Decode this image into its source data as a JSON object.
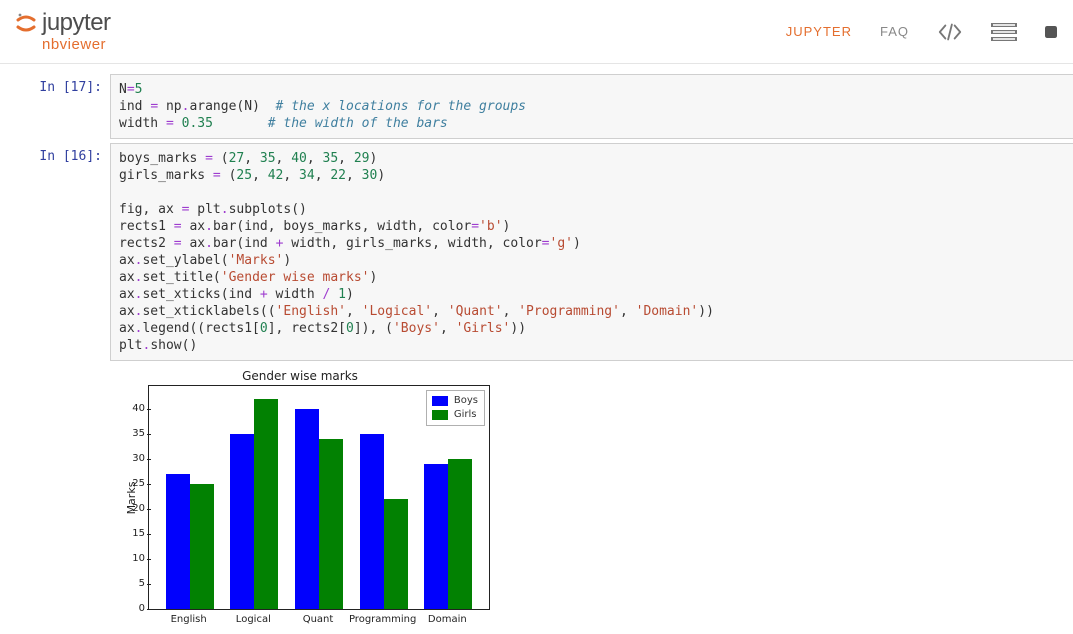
{
  "header": {
    "logo_main": "jupyter",
    "logo_sub": "nbviewer",
    "nav": {
      "jupyter": "JUPYTER",
      "faq": "FAQ"
    }
  },
  "cells": {
    "c17_prompt": "In [17]:",
    "c17": {
      "l1a": "N",
      "l1b": "=",
      "l1c": "5",
      "l2a": "ind ",
      "l2b": "=",
      "l2c": " np",
      "l2d": ".",
      "l2e": "arange(N)  ",
      "l2cm": "# the x locations for the groups",
      "l3a": "width ",
      "l3b": "=",
      "l3c": " ",
      "l3d": "0.35",
      "l3e": "       ",
      "l3cm": "# the width of the bars"
    },
    "c16_prompt": "In [16]:",
    "c16": {
      "l1a": "boys_marks ",
      "l1b": "=",
      "l1c": " (",
      "l1d": "27",
      "l1e": ", ",
      "l1f": "35",
      "l1g": ", ",
      "l1h": "40",
      "l1i": ", ",
      "l1j": "35",
      "l1k": ", ",
      "l1l": "29",
      "l1m": ")",
      "l2a": "girls_marks ",
      "l2b": "=",
      "l2c": " (",
      "l2d": "25",
      "l2e": ", ",
      "l2f": "42",
      "l2g": ", ",
      "l2h": "34",
      "l2i": ", ",
      "l2j": "22",
      "l2k": ", ",
      "l2l": "30",
      "l2m": ")",
      "l4a": "fig, ax ",
      "l4b": "=",
      "l4c": " plt",
      "l4d": ".",
      "l4e": "subplots()",
      "l5a": "rects1 ",
      "l5b": "=",
      "l5c": " ax",
      "l5d": ".",
      "l5e": "bar(ind, boys_marks, width, color",
      "l5f": "=",
      "l5g": "'b'",
      "l5h": ")",
      "l6a": "rects2 ",
      "l6b": "=",
      "l6c": " ax",
      "l6d": ".",
      "l6e": "bar(ind ",
      "l6f": "+",
      "l6g": " width, girls_marks, width, color",
      "l6h": "=",
      "l6i": "'g'",
      "l6j": ")",
      "l7a": "ax",
      "l7b": ".",
      "l7c": "set_ylabel(",
      "l7d": "'Marks'",
      "l7e": ")",
      "l8a": "ax",
      "l8b": ".",
      "l8c": "set_title(",
      "l8d": "'Gender wise marks'",
      "l8e": ")",
      "l9a": "ax",
      "l9b": ".",
      "l9c": "set_xticks(ind ",
      "l9d": "+",
      "l9e": " width ",
      "l9f": "/",
      "l9g": " ",
      "l9h": "1",
      "l9i": ")",
      "l10a": "ax",
      "l10b": ".",
      "l10c": "set_xticklabels((",
      "l10d": "'English'",
      "l10e": ", ",
      "l10f": "'Logical'",
      "l10g": ", ",
      "l10h": "'Quant'",
      "l10i": ", ",
      "l10j": "'Programming'",
      "l10k": ", ",
      "l10l": "'Domain'",
      "l10m": "))",
      "l11a": "ax",
      "l11b": ".",
      "l11c": "legend((rects1[",
      "l11d": "0",
      "l11e": "], rects2[",
      "l11f": "0",
      "l11g": "]), (",
      "l11h": "'Boys'",
      "l11i": ", ",
      "l11j": "'Girls'",
      "l11k": "))",
      "l12a": "plt",
      "l12b": ".",
      "l12c": "show()"
    }
  },
  "chart_data": {
    "type": "bar",
    "title": "Gender wise marks",
    "ylabel": "Marks",
    "categories": [
      "English",
      "Logical",
      "Quant",
      "Programming",
      "Domain"
    ],
    "series": [
      {
        "name": "Boys",
        "color": "#0101fd",
        "values": [
          27,
          35,
          40,
          35,
          29
        ]
      },
      {
        "name": "Girls",
        "color": "#028102",
        "values": [
          25,
          42,
          34,
          22,
          30
        ]
      }
    ],
    "ylim": [
      0,
      45
    ],
    "yticks": [
      0,
      5,
      10,
      15,
      20,
      25,
      30,
      35,
      40
    ]
  }
}
